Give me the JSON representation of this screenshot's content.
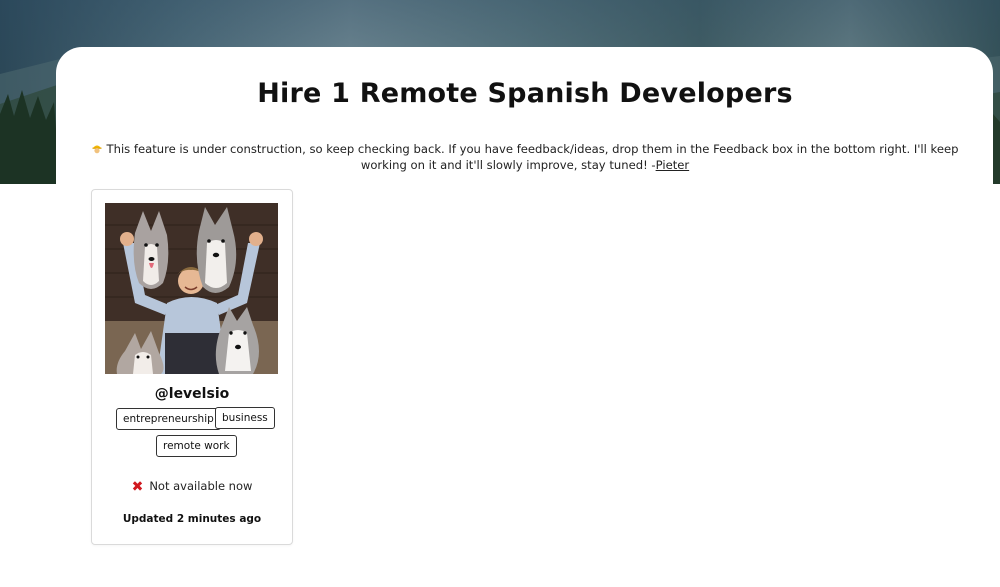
{
  "page": {
    "title": "Hire 1 Remote Spanish Developers"
  },
  "notice": {
    "icon": "construction-worker-icon",
    "text": "This feature is under construction, so keep checking back. If you have feedback/ideas, drop them in the Feedback box in the bottom right. I'll keep working on it and it'll slowly improve, stay tuned! -",
    "author_link": "Pieter"
  },
  "profile": {
    "username": "@levelsio",
    "tags": [
      "entrepreneurship",
      "business",
      "remote work"
    ],
    "availability_icon": "red-x-icon",
    "availability_symbol": "✖",
    "availability_text": "Not available now",
    "updated_text": "Updated 2 minutes ago",
    "availability_color": "#d0181f"
  }
}
